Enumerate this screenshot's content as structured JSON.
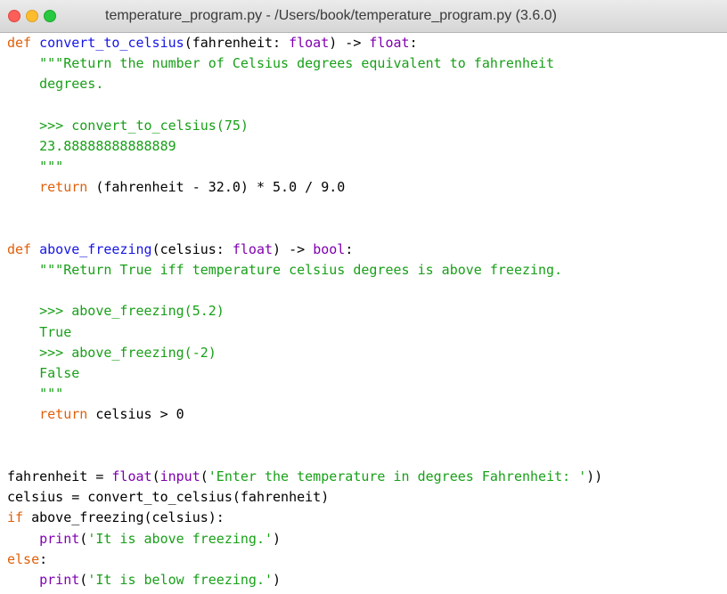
{
  "window": {
    "title": "temperature_program.py - /Users/book/temperature_program.py (3.6.0)"
  },
  "colors": {
    "keyword": "#e0600a",
    "function_def": "#1515e6",
    "builtin": "#8000b0",
    "string": "#18a018",
    "default": "#000000"
  },
  "code": [
    [
      {
        "t": "kw",
        "v": "def"
      },
      {
        "t": "",
        "v": " "
      },
      {
        "t": "fn",
        "v": "convert_to_celsius"
      },
      {
        "t": "",
        "v": "(fahrenheit: "
      },
      {
        "t": "builtin",
        "v": "float"
      },
      {
        "t": "",
        "v": ") -> "
      },
      {
        "t": "builtin",
        "v": "float"
      },
      {
        "t": "",
        "v": ":"
      }
    ],
    [
      {
        "t": "str",
        "v": "    \"\"\"Return the number of Celsius degrees equivalent to fahrenheit"
      }
    ],
    [
      {
        "t": "str",
        "v": "    degrees."
      }
    ],
    [],
    [
      {
        "t": "str",
        "v": "    >>> convert_to_celsius(75)"
      }
    ],
    [
      {
        "t": "str",
        "v": "    23.88888888888889"
      }
    ],
    [
      {
        "t": "str",
        "v": "    \"\"\""
      }
    ],
    [
      {
        "t": "",
        "v": "    "
      },
      {
        "t": "kw",
        "v": "return"
      },
      {
        "t": "",
        "v": " (fahrenheit - 32.0) * 5.0 / 9.0"
      }
    ],
    [],
    [],
    [
      {
        "t": "kw",
        "v": "def"
      },
      {
        "t": "",
        "v": " "
      },
      {
        "t": "fn",
        "v": "above_freezing"
      },
      {
        "t": "",
        "v": "(celsius: "
      },
      {
        "t": "builtin",
        "v": "float"
      },
      {
        "t": "",
        "v": ") -> "
      },
      {
        "t": "builtin",
        "v": "bool"
      },
      {
        "t": "",
        "v": ":"
      }
    ],
    [
      {
        "t": "str",
        "v": "    \"\"\"Return True iff temperature celsius degrees is above freezing."
      }
    ],
    [],
    [
      {
        "t": "str",
        "v": "    >>> above_freezing(5.2)"
      }
    ],
    [
      {
        "t": "str",
        "v": "    True"
      }
    ],
    [
      {
        "t": "str",
        "v": "    >>> above_freezing(-2)"
      }
    ],
    [
      {
        "t": "str",
        "v": "    False"
      }
    ],
    [
      {
        "t": "str",
        "v": "    \"\"\""
      }
    ],
    [
      {
        "t": "",
        "v": "    "
      },
      {
        "t": "kw",
        "v": "return"
      },
      {
        "t": "",
        "v": " celsius > 0"
      }
    ],
    [],
    [],
    [
      {
        "t": "",
        "v": "fahrenheit = "
      },
      {
        "t": "builtin",
        "v": "float"
      },
      {
        "t": "",
        "v": "("
      },
      {
        "t": "builtin",
        "v": "input"
      },
      {
        "t": "",
        "v": "("
      },
      {
        "t": "str",
        "v": "'Enter the temperature in degrees Fahrenheit: '"
      },
      {
        "t": "",
        "v": "))"
      }
    ],
    [
      {
        "t": "",
        "v": "celsius = convert_to_celsius(fahrenheit)"
      }
    ],
    [
      {
        "t": "kw",
        "v": "if"
      },
      {
        "t": "",
        "v": " above_freezing(celsius):"
      }
    ],
    [
      {
        "t": "",
        "v": "    "
      },
      {
        "t": "builtin",
        "v": "print"
      },
      {
        "t": "",
        "v": "("
      },
      {
        "t": "str",
        "v": "'It is above freezing.'"
      },
      {
        "t": "",
        "v": ")"
      }
    ],
    [
      {
        "t": "kw",
        "v": "else"
      },
      {
        "t": "",
        "v": ":"
      }
    ],
    [
      {
        "t": "",
        "v": "    "
      },
      {
        "t": "builtin",
        "v": "print"
      },
      {
        "t": "",
        "v": "("
      },
      {
        "t": "str",
        "v": "'It is below freezing.'"
      },
      {
        "t": "",
        "v": ")"
      }
    ]
  ]
}
